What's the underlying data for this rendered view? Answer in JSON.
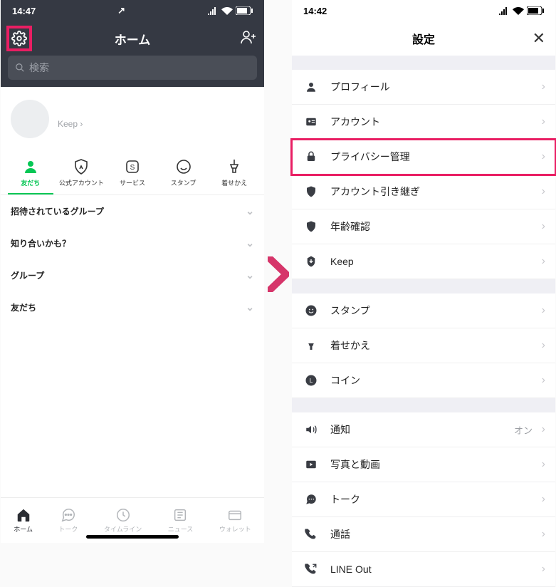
{
  "left": {
    "status": {
      "time": "14:47"
    },
    "nav": {
      "title": "ホーム"
    },
    "search": {
      "placeholder": "検索"
    },
    "profile": {
      "keep": "Keep"
    },
    "home_tabs": [
      {
        "label": "友だち"
      },
      {
        "label": "公式アカウント"
      },
      {
        "label": "サービス"
      },
      {
        "label": "スタンプ"
      },
      {
        "label": "着せかえ"
      }
    ],
    "expand_rows": [
      {
        "label": "招待されているグループ"
      },
      {
        "label": "知り合いかも？"
      },
      {
        "label": "グループ"
      },
      {
        "label": "友だち"
      }
    ],
    "bottom_tabs": [
      {
        "label": "ホーム"
      },
      {
        "label": "トーク"
      },
      {
        "label": "タイムライン"
      },
      {
        "label": "ニュース"
      },
      {
        "label": "ウォレット"
      }
    ]
  },
  "right": {
    "status": {
      "time": "14:42"
    },
    "nav": {
      "title": "設定"
    },
    "sections": [
      [
        {
          "label": "プロフィール",
          "icon": "person"
        },
        {
          "label": "アカウント",
          "icon": "id"
        },
        {
          "label": "プライバシー管理",
          "icon": "lock",
          "highlight": true
        },
        {
          "label": "アカウント引き継ぎ",
          "icon": "shield"
        },
        {
          "label": "年齢確認",
          "icon": "shield"
        },
        {
          "label": "Keep",
          "icon": "download"
        }
      ],
      [
        {
          "label": "スタンプ",
          "icon": "smile"
        },
        {
          "label": "着せかえ",
          "icon": "brush"
        },
        {
          "label": "コイン",
          "icon": "coin"
        }
      ],
      [
        {
          "label": "通知",
          "icon": "speaker",
          "side": "オン"
        },
        {
          "label": "写真と動画",
          "icon": "media"
        },
        {
          "label": "トーク",
          "icon": "chat"
        },
        {
          "label": "通話",
          "icon": "phone"
        },
        {
          "label": "LINE Out",
          "icon": "phone-out"
        }
      ]
    ]
  }
}
